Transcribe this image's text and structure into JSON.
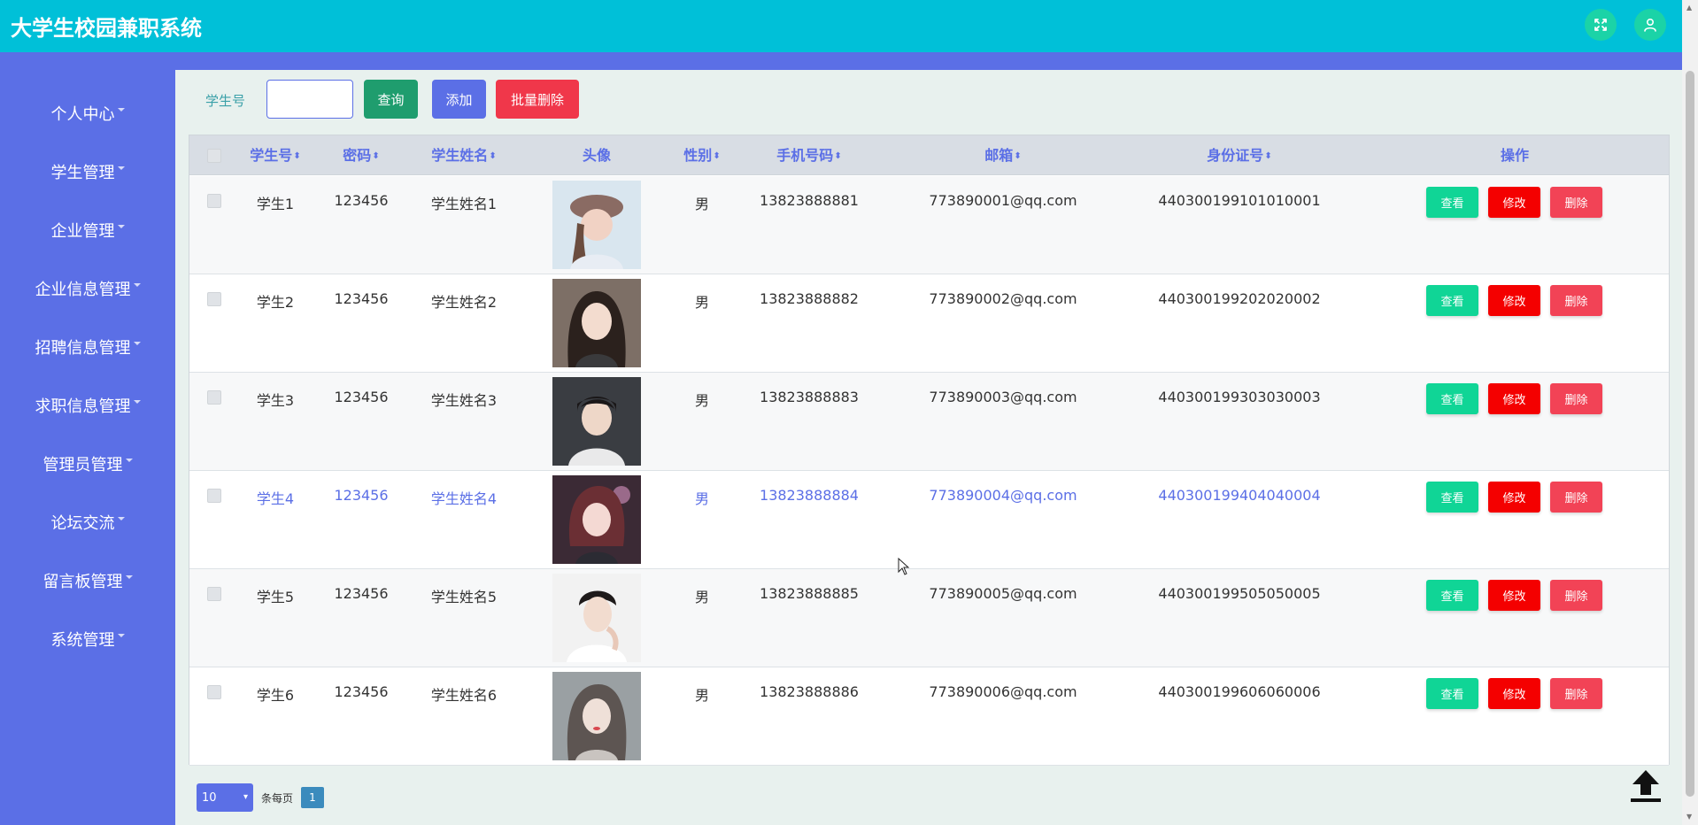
{
  "header": {
    "title": "大学生校园兼职系统"
  },
  "sidebar": {
    "items": [
      {
        "label": "个人中心"
      },
      {
        "label": "学生管理"
      },
      {
        "label": "企业管理"
      },
      {
        "label": "企业信息管理"
      },
      {
        "label": "招聘信息管理"
      },
      {
        "label": "求职信息管理"
      },
      {
        "label": "管理员管理"
      },
      {
        "label": "论坛交流"
      },
      {
        "label": "留言板管理"
      },
      {
        "label": "系统管理"
      }
    ]
  },
  "toolbar": {
    "search_label": "学生号",
    "search_value": "",
    "query_label": "查询",
    "add_label": "添加",
    "batch_delete_label": "批量删除"
  },
  "table": {
    "columns": {
      "student_no": "学生号",
      "password": "密码",
      "name": "学生姓名",
      "avatar": "头像",
      "gender": "性别",
      "phone": "手机号码",
      "email": "邮箱",
      "id_card": "身份证号",
      "actions": "操作"
    },
    "rows": [
      {
        "student_no": "学生1",
        "password": "123456",
        "name": "学生姓名1",
        "gender": "男",
        "phone": "13823888881",
        "email": "773890001@qq.com",
        "id_card": "440300199101010001"
      },
      {
        "student_no": "学生2",
        "password": "123456",
        "name": "学生姓名2",
        "gender": "男",
        "phone": "13823888882",
        "email": "773890002@qq.com",
        "id_card": "440300199202020002"
      },
      {
        "student_no": "学生3",
        "password": "123456",
        "name": "学生姓名3",
        "gender": "男",
        "phone": "13823888883",
        "email": "773890003@qq.com",
        "id_card": "440300199303030003"
      },
      {
        "student_no": "学生4",
        "password": "123456",
        "name": "学生姓名4",
        "gender": "男",
        "phone": "13823888884",
        "email": "773890004@qq.com",
        "id_card": "440300199404040004"
      },
      {
        "student_no": "学生5",
        "password": "123456",
        "name": "学生姓名5",
        "gender": "男",
        "phone": "13823888885",
        "email": "773890005@qq.com",
        "id_card": "440300199505050005"
      },
      {
        "student_no": "学生6",
        "password": "123456",
        "name": "学生姓名6",
        "gender": "男",
        "phone": "13823888886",
        "email": "773890006@qq.com",
        "id_card": "440300199606060006"
      }
    ],
    "row_actions": {
      "view": "查看",
      "edit": "修改",
      "delete": "删除"
    }
  },
  "pagination": {
    "page_size": "10",
    "per_page_label": "条每页",
    "current_page": "1"
  },
  "icons": {
    "fullscreen": "fullscreen-icon",
    "user": "user-icon",
    "back_to_top": "arrow-up-icon",
    "sort": "sort-icon"
  },
  "colors": {
    "header_bg": "#00c0d8",
    "sidebar_bg": "#5b6fe6",
    "query_btn": "#1f9d6e",
    "add_btn": "#5b6fe6",
    "batch_delete_btn": "#f0374a",
    "view_btn": "#10d596",
    "edit_btn": "#f40000",
    "delete_btn": "#f24356",
    "header_icon_bg": "#1bd3a7"
  }
}
